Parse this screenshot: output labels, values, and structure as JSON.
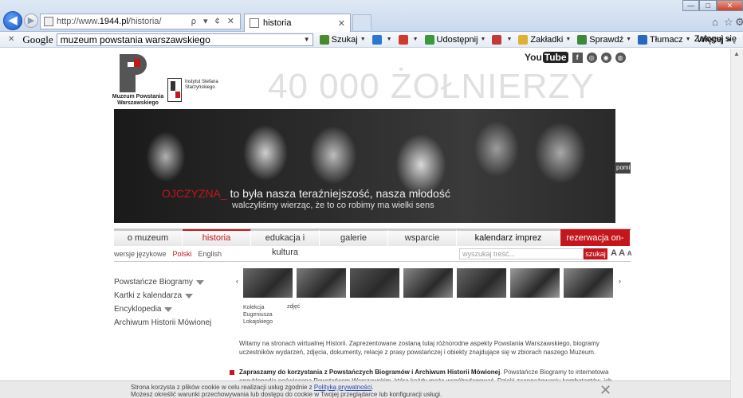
{
  "browser": {
    "address": {
      "prefix": "http://www.",
      "domain": "1944.pl",
      "path": "/historia/",
      "tools": "ρ ▾ ¢ ✕"
    },
    "tab": {
      "title": "historia",
      "close": "✕"
    },
    "window_controls": {
      "minimize": "—",
      "maximize": "□",
      "close": "✕"
    },
    "right_icons": {
      "home": "⌂",
      "favorites": "☆",
      "settings": "⚙"
    }
  },
  "google_toolbar": {
    "close": "✕",
    "logo": "Google",
    "query": "muzeum powstania warszawskiego",
    "items": [
      {
        "label": "Szukaj",
        "color": "#4a8a2a"
      },
      {
        "label": "",
        "color": "#2a78d0"
      },
      {
        "label": "",
        "color": "#d03a2a"
      },
      {
        "label": "Udostępnij",
        "color": "#3a9a3a"
      },
      {
        "label": "",
        "color": "#c03a3a"
      },
      {
        "label": "Zakładki",
        "color": "#e0b030"
      },
      {
        "label": "Sprawdź",
        "color": "#3a8a3a"
      },
      {
        "label": "Tłumacz",
        "color": "#2a68c0"
      },
      {
        "label": "Więcej »",
        "color": ""
      }
    ],
    "login": "Zaloguj się"
  },
  "site": {
    "social": {
      "youtube_a": "You",
      "youtube_b": "Tube",
      "facebook": "f",
      "icon3": "◎",
      "icon4": "◉",
      "icon5": "◍"
    },
    "logo_mpw_caption": "Muzeum Powstania Warszawskiego",
    "logo_iss_caption": "Instytut Stefana Starzyńskiego",
    "headline": "40 000 ŻOŁNIERZY",
    "hero": {
      "slogan_red": "OJCZYZNA_",
      "slogan_rest": " to była nasza teraźniejszość, nasza młodość",
      "slogan_line2": "walczyliśmy wierząc, że to co robimy ma wielki sens",
      "pomin": "pomiń"
    },
    "menu": [
      {
        "label": "o muzeum",
        "w": 86,
        "type": ""
      },
      {
        "label": "historia",
        "w": 86,
        "type": "active"
      },
      {
        "label": "edukacja i kultura",
        "w": 86,
        "type": ""
      },
      {
        "label": "galerie",
        "w": 86,
        "type": ""
      },
      {
        "label": "wsparcie",
        "w": 86,
        "type": ""
      },
      {
        "label": "kalendarz imprez",
        "w": 130,
        "type": "dark"
      },
      {
        "label": "rezerwacja on-line",
        "w": 88,
        "type": "res"
      }
    ],
    "lang": {
      "label": "wersje językowe",
      "polish": "Polski",
      "english": "English"
    },
    "search": {
      "placeholder": "wyszukaj treść...",
      "button": "szukaj"
    },
    "font_size": {
      "large": "A A",
      "small": "A"
    },
    "sidenav": [
      {
        "label": "Powstańcze Biogramy",
        "has_menu": true
      },
      {
        "label": "Kartki z kalendarza",
        "has_menu": true
      },
      {
        "label": "Encyklopedia",
        "has_menu": true
      },
      {
        "label": "Archiwum Historii Mówionej",
        "has_menu": false
      }
    ],
    "gallery": {
      "prev": "‹",
      "next": "›",
      "caption_left": "Kolekcja Eugeniusza Lokajskiego",
      "caption_right": "zdjęć",
      "thumb_tones": [
        "#6a6a6a",
        "#7a7a7a",
        "#555555",
        "#888888",
        "#666666",
        "#9a9a9a",
        "#8a8a8a"
      ]
    },
    "intro": "Witamy na stronach wirtualnej Historii. Zaprezentowane zostaną tutaj różnorodne aspekty Powstania Warszawskiego, biogramy uczestników wydarzeń, zdjęcia, dokumenty, relacje z prasy powstańczej i obiekty znajdujące się w zbiorach naszego Muzeum.",
    "bullet_bold": "Zapraszamy do korzystania z Powstańczych Biogramów i Archiwum Historii Mówionej",
    "bullet_rest": ". Powstańcze Biogramy to internetowa encyklopedia poświęcona Powstańcom Warszawskim, którą każdy może współredagować. Dzięki zaangażowaniu kombatantów, ich rodzin i",
    "cookie": {
      "line1_a": "Strona korzysta z plików cookie w celu realizacji usług zgodnie z ",
      "line1_link": "Polityką prywatności",
      "line1_b": ".",
      "line2": "Możesz określić warunki przechowywania lub dostępu do cookie w Twojej przeglądarce lub konfiguracji usługi.",
      "close": "✕"
    }
  }
}
